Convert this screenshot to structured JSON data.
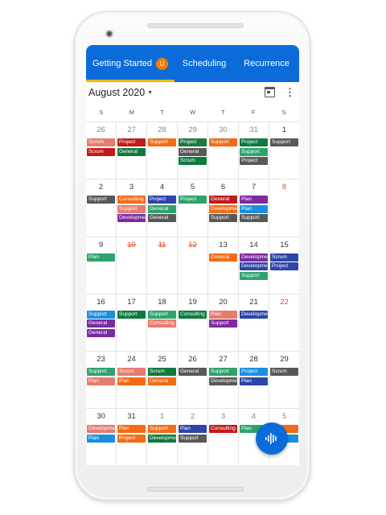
{
  "tabs": [
    {
      "label": "Getting Started",
      "badge": "U"
    },
    {
      "label": "Scheduling"
    },
    {
      "label": "Recurrence"
    }
  ],
  "header": {
    "month": "August 2020",
    "icons": [
      "calendar-icon",
      "more-vertical-icon"
    ]
  },
  "weekdays": [
    "S",
    "M",
    "T",
    "W",
    "T",
    "F",
    "S"
  ],
  "colors": {
    "Scrum": "#1e8a5a",
    "Support": "#5a5a5a",
    "Project": "#c0161b",
    "General": "#1e8a5a",
    "Consulting": "#d8342c",
    "Development": "#7b2aa0",
    "Plan": "#1a8fe0"
  },
  "weeks": [
    [
      {
        "num": "26",
        "style": "muted",
        "events": [
          {
            "label": "Scrum",
            "color": "#e57c6f"
          },
          {
            "label": "Scrum",
            "color": "#c21a1a"
          }
        ]
      },
      {
        "num": "27",
        "style": "muted",
        "events": [
          {
            "label": "Project",
            "color": "#c21a1a"
          },
          {
            "label": "General",
            "color": "#0d7a3e"
          }
        ]
      },
      {
        "num": "28",
        "style": "muted",
        "events": [
          {
            "label": "Support",
            "color": "#f36b16"
          }
        ]
      },
      {
        "num": "29",
        "style": "muted",
        "events": [
          {
            "label": "Project",
            "color": "#1d7a3e"
          },
          {
            "label": "General",
            "color": "#585858"
          },
          {
            "label": "Scrum",
            "color": "#0d7a3e"
          }
        ]
      },
      {
        "num": "30",
        "style": "muted",
        "events": [
          {
            "label": "Support",
            "color": "#f36b16"
          }
        ]
      },
      {
        "num": "31",
        "style": "muted",
        "events": [
          {
            "label": "Project",
            "color": "#0d7a3e"
          },
          {
            "label": "Support",
            "color": "#2ea36b"
          },
          {
            "label": "Project",
            "color": "#585858"
          }
        ]
      },
      {
        "num": "1",
        "style": "",
        "events": [
          {
            "label": "Support",
            "color": "#585858"
          }
        ]
      }
    ],
    [
      {
        "num": "2",
        "style": "",
        "events": [
          {
            "label": "Support",
            "color": "#585858"
          }
        ]
      },
      {
        "num": "3",
        "style": "",
        "events": [
          {
            "label": "Consulting",
            "color": "#f36b16"
          },
          {
            "label": "Support",
            "color": "#e57c6f"
          },
          {
            "label": "Development",
            "color": "#7b2aa0"
          }
        ]
      },
      {
        "num": "4",
        "style": "",
        "events": [
          {
            "label": "Project",
            "color": "#2d45a8"
          },
          {
            "label": "General",
            "color": "#2ea36b"
          },
          {
            "label": "General",
            "color": "#585858"
          }
        ]
      },
      {
        "num": "5",
        "style": "",
        "events": [
          {
            "label": "Project",
            "color": "#2ea36b"
          }
        ]
      },
      {
        "num": "6",
        "style": "",
        "events": [
          {
            "label": "General",
            "color": "#c21a1a"
          },
          {
            "label": "Development",
            "color": "#f36b16"
          },
          {
            "label": "Support",
            "color": "#585858"
          }
        ]
      },
      {
        "num": "7",
        "style": "",
        "events": [
          {
            "label": "Plan",
            "color": "#7b2aa0"
          },
          {
            "label": "Plan",
            "color": "#1a8fe0"
          },
          {
            "label": "Support",
            "color": "#585858"
          }
        ]
      },
      {
        "num": "8",
        "style": "red",
        "events": []
      }
    ],
    [
      {
        "num": "9",
        "style": "",
        "events": [
          {
            "label": "Plan",
            "color": "#2ea36b"
          }
        ]
      },
      {
        "num": "10",
        "style": "strike",
        "events": []
      },
      {
        "num": "11",
        "style": "strike",
        "events": []
      },
      {
        "num": "12",
        "style": "strike",
        "events": []
      },
      {
        "num": "13",
        "style": "",
        "events": [
          {
            "label": "General",
            "color": "#f36b16"
          }
        ]
      },
      {
        "num": "14",
        "style": "",
        "events": [
          {
            "label": "Development",
            "color": "#7b2aa0"
          },
          {
            "label": "Development",
            "color": "#2d45a8"
          },
          {
            "label": "Support",
            "color": "#2ea36b"
          }
        ]
      },
      {
        "num": "15",
        "style": "",
        "events": [
          {
            "label": "Scrum",
            "color": "#2d45a8"
          },
          {
            "label": "Project",
            "color": "#2d45a8"
          }
        ]
      }
    ],
    [
      {
        "num": "16",
        "style": "",
        "events": [
          {
            "label": "Support",
            "color": "#1a8fe0"
          },
          {
            "label": "General",
            "color": "#7b2aa0"
          },
          {
            "label": "General",
            "color": "#7b2aa0"
          }
        ]
      },
      {
        "num": "17",
        "style": "",
        "events": [
          {
            "label": "Support",
            "color": "#0d7a3e"
          }
        ]
      },
      {
        "num": "18",
        "style": "",
        "events": [
          {
            "label": "Support",
            "color": "#2ea36b"
          },
          {
            "label": "Consulting",
            "color": "#e57c6f"
          }
        ]
      },
      {
        "num": "19",
        "style": "",
        "events": [
          {
            "label": "Consulting",
            "color": "#0d7a3e"
          }
        ]
      },
      {
        "num": "20",
        "style": "",
        "events": [
          {
            "label": "Plan",
            "color": "#e57c6f"
          },
          {
            "label": "Support",
            "color": "#7b2aa0"
          }
        ]
      },
      {
        "num": "21",
        "style": "",
        "events": [
          {
            "label": "Development",
            "color": "#2d45a8"
          }
        ]
      },
      {
        "num": "22",
        "style": "red",
        "events": []
      }
    ],
    [
      {
        "num": "23",
        "style": "",
        "events": [
          {
            "label": "Support",
            "color": "#2ea36b"
          },
          {
            "label": "Plan",
            "color": "#e57c6f"
          }
        ]
      },
      {
        "num": "24",
        "style": "",
        "events": [
          {
            "label": "Scrum",
            "color": "#e57c6f"
          },
          {
            "label": "Plan",
            "color": "#f36b16"
          }
        ]
      },
      {
        "num": "25",
        "style": "",
        "events": [
          {
            "label": "Scrum",
            "color": "#0d7a3e"
          },
          {
            "label": "General",
            "color": "#f36b16"
          }
        ]
      },
      {
        "num": "26",
        "style": "",
        "events": [
          {
            "label": "General",
            "color": "#585858"
          }
        ]
      },
      {
        "num": "27",
        "style": "",
        "events": [
          {
            "label": "Support",
            "color": "#2ea36b"
          },
          {
            "label": "Development",
            "color": "#585858"
          }
        ]
      },
      {
        "num": "28",
        "style": "",
        "events": [
          {
            "label": "Project",
            "color": "#1a8fe0"
          },
          {
            "label": "Plan",
            "color": "#2d45a8"
          }
        ]
      },
      {
        "num": "29",
        "style": "",
        "events": [
          {
            "label": "Scrum",
            "color": "#585858"
          }
        ]
      }
    ],
    [
      {
        "num": "30",
        "style": "",
        "events": [
          {
            "label": "Development",
            "color": "#e57c6f"
          },
          {
            "label": "Plan",
            "color": "#1a8fe0"
          }
        ]
      },
      {
        "num": "31",
        "style": "",
        "events": [
          {
            "label": "Plan",
            "color": "#f36b16"
          },
          {
            "label": "Project",
            "color": "#f36b16"
          }
        ]
      },
      {
        "num": "1",
        "style": "muted",
        "events": [
          {
            "label": "Support",
            "color": "#f36b16"
          },
          {
            "label": "Development",
            "color": "#0d7a3e"
          }
        ]
      },
      {
        "num": "2",
        "style": "muted",
        "events": [
          {
            "label": "Plan",
            "color": "#2d45a8"
          },
          {
            "label": "Support",
            "color": "#585858"
          }
        ]
      },
      {
        "num": "3",
        "style": "muted",
        "events": [
          {
            "label": "Consulting",
            "color": "#c21a1a"
          }
        ]
      },
      {
        "num": "4",
        "style": "muted",
        "events": [
          {
            "label": "Plan",
            "color": "#2ea36b"
          }
        ]
      },
      {
        "num": "5",
        "style": "muted",
        "events": [
          {
            "label": "",
            "color": "#f36b16"
          },
          {
            "label": "",
            "color": "#1a8fe0"
          }
        ]
      }
    ]
  ]
}
